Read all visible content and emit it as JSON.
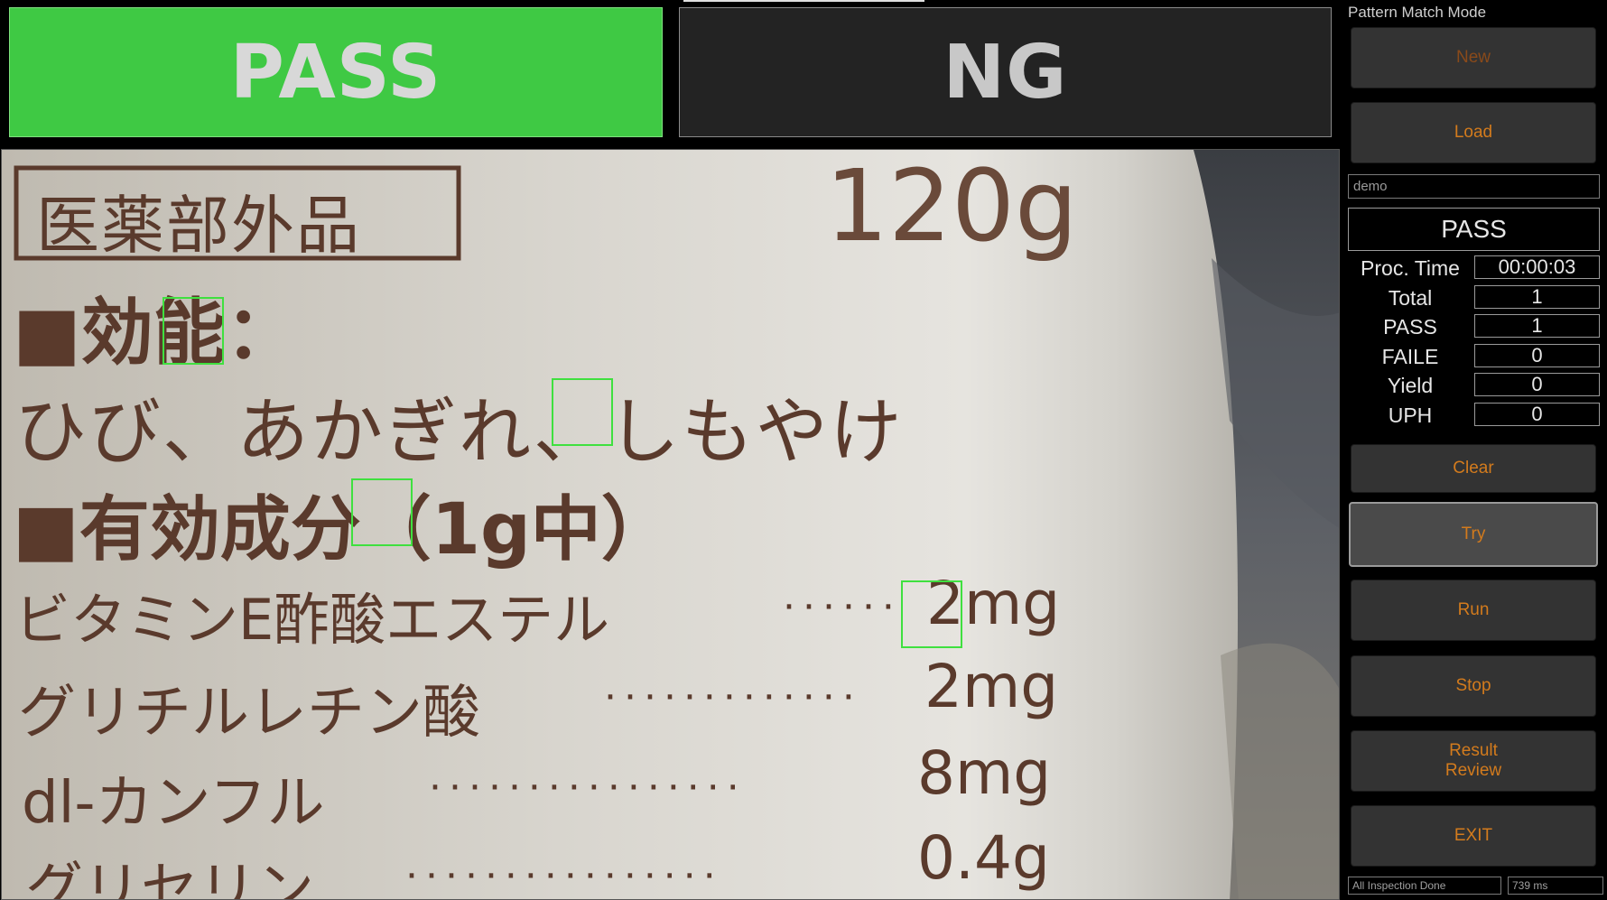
{
  "verdicts": {
    "pass_label": "PASS",
    "ng_label": "NG"
  },
  "colors": {
    "pass_green": "#3fc944",
    "button_text_orange": "#d37b1d",
    "match_box_green": "#3fe03f"
  },
  "camera": {
    "label_text": {
      "category": "医薬部外品",
      "net_weight": "120g",
      "efficacy_heading": "■効能：",
      "efficacy_text": "ひび、あかぎれ、しもやけ",
      "ingredients_heading": "■有効成分（1g中）",
      "ingredients": [
        {
          "name": "ビタミンE酢酸エステル",
          "amount": "2mg"
        },
        {
          "name": "グリチルレチン酸",
          "amount": "2mg"
        },
        {
          "name": "dl-カンフル",
          "amount": "8mg"
        },
        {
          "name": "グリセリン",
          "amount": "0.4g"
        }
      ]
    },
    "match_count": 4
  },
  "panel": {
    "mode_title": "Pattern Match Mode",
    "buttons": {
      "new": "New",
      "load": "Load",
      "clear": "Clear",
      "try": "Try",
      "run": "Run",
      "stop": "Stop",
      "result_review": "Result\nReview",
      "exit": "EXIT"
    },
    "recipe_name": "demo",
    "result": "PASS",
    "stats": [
      {
        "label": "Proc. Time",
        "value": "00:00:03"
      },
      {
        "label": "Total",
        "value": "1"
      },
      {
        "label": "PASS",
        "value": "1"
      },
      {
        "label": "FAILE",
        "value": "0"
      },
      {
        "label": "Yield",
        "value": "0"
      },
      {
        "label": "UPH",
        "value": "0"
      }
    ],
    "status_message": "All Inspection Done",
    "cycle_time": "739 ms"
  }
}
